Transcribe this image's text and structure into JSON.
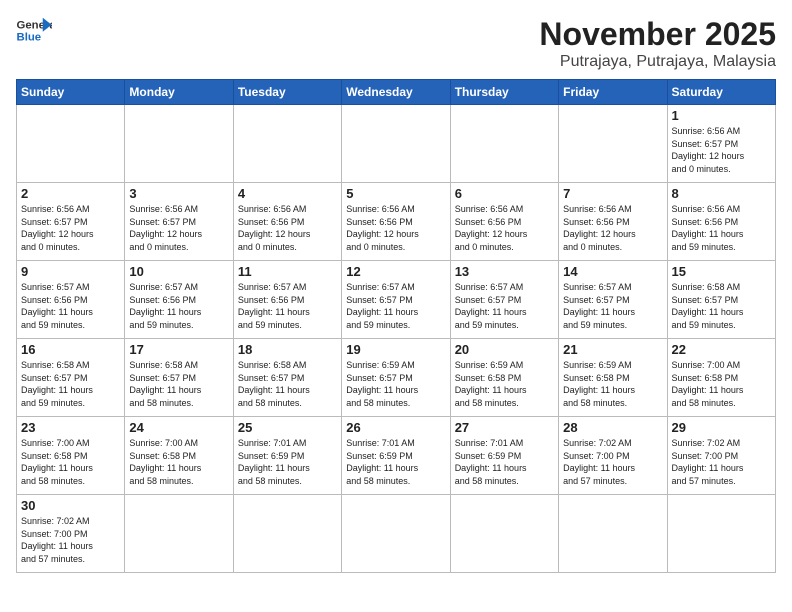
{
  "header": {
    "logo_line1": "General",
    "logo_line2": "Blue",
    "month_title": "November 2025",
    "location": "Putrajaya, Putrajaya, Malaysia"
  },
  "weekdays": [
    "Sunday",
    "Monday",
    "Tuesday",
    "Wednesday",
    "Thursday",
    "Friday",
    "Saturday"
  ],
  "weeks": [
    [
      {
        "day": "",
        "info": ""
      },
      {
        "day": "",
        "info": ""
      },
      {
        "day": "",
        "info": ""
      },
      {
        "day": "",
        "info": ""
      },
      {
        "day": "",
        "info": ""
      },
      {
        "day": "",
        "info": ""
      },
      {
        "day": "1",
        "info": "Sunrise: 6:56 AM\nSunset: 6:57 PM\nDaylight: 12 hours\nand 0 minutes."
      }
    ],
    [
      {
        "day": "2",
        "info": "Sunrise: 6:56 AM\nSunset: 6:57 PM\nDaylight: 12 hours\nand 0 minutes."
      },
      {
        "day": "3",
        "info": "Sunrise: 6:56 AM\nSunset: 6:57 PM\nDaylight: 12 hours\nand 0 minutes."
      },
      {
        "day": "4",
        "info": "Sunrise: 6:56 AM\nSunset: 6:56 PM\nDaylight: 12 hours\nand 0 minutes."
      },
      {
        "day": "5",
        "info": "Sunrise: 6:56 AM\nSunset: 6:56 PM\nDaylight: 12 hours\nand 0 minutes."
      },
      {
        "day": "6",
        "info": "Sunrise: 6:56 AM\nSunset: 6:56 PM\nDaylight: 12 hours\nand 0 minutes."
      },
      {
        "day": "7",
        "info": "Sunrise: 6:56 AM\nSunset: 6:56 PM\nDaylight: 12 hours\nand 0 minutes."
      },
      {
        "day": "8",
        "info": "Sunrise: 6:56 AM\nSunset: 6:56 PM\nDaylight: 11 hours\nand 59 minutes."
      }
    ],
    [
      {
        "day": "9",
        "info": "Sunrise: 6:57 AM\nSunset: 6:56 PM\nDaylight: 11 hours\nand 59 minutes."
      },
      {
        "day": "10",
        "info": "Sunrise: 6:57 AM\nSunset: 6:56 PM\nDaylight: 11 hours\nand 59 minutes."
      },
      {
        "day": "11",
        "info": "Sunrise: 6:57 AM\nSunset: 6:56 PM\nDaylight: 11 hours\nand 59 minutes."
      },
      {
        "day": "12",
        "info": "Sunrise: 6:57 AM\nSunset: 6:57 PM\nDaylight: 11 hours\nand 59 minutes."
      },
      {
        "day": "13",
        "info": "Sunrise: 6:57 AM\nSunset: 6:57 PM\nDaylight: 11 hours\nand 59 minutes."
      },
      {
        "day": "14",
        "info": "Sunrise: 6:57 AM\nSunset: 6:57 PM\nDaylight: 11 hours\nand 59 minutes."
      },
      {
        "day": "15",
        "info": "Sunrise: 6:58 AM\nSunset: 6:57 PM\nDaylight: 11 hours\nand 59 minutes."
      }
    ],
    [
      {
        "day": "16",
        "info": "Sunrise: 6:58 AM\nSunset: 6:57 PM\nDaylight: 11 hours\nand 59 minutes."
      },
      {
        "day": "17",
        "info": "Sunrise: 6:58 AM\nSunset: 6:57 PM\nDaylight: 11 hours\nand 58 minutes."
      },
      {
        "day": "18",
        "info": "Sunrise: 6:58 AM\nSunset: 6:57 PM\nDaylight: 11 hours\nand 58 minutes."
      },
      {
        "day": "19",
        "info": "Sunrise: 6:59 AM\nSunset: 6:57 PM\nDaylight: 11 hours\nand 58 minutes."
      },
      {
        "day": "20",
        "info": "Sunrise: 6:59 AM\nSunset: 6:58 PM\nDaylight: 11 hours\nand 58 minutes."
      },
      {
        "day": "21",
        "info": "Sunrise: 6:59 AM\nSunset: 6:58 PM\nDaylight: 11 hours\nand 58 minutes."
      },
      {
        "day": "22",
        "info": "Sunrise: 7:00 AM\nSunset: 6:58 PM\nDaylight: 11 hours\nand 58 minutes."
      }
    ],
    [
      {
        "day": "23",
        "info": "Sunrise: 7:00 AM\nSunset: 6:58 PM\nDaylight: 11 hours\nand 58 minutes."
      },
      {
        "day": "24",
        "info": "Sunrise: 7:00 AM\nSunset: 6:58 PM\nDaylight: 11 hours\nand 58 minutes."
      },
      {
        "day": "25",
        "info": "Sunrise: 7:01 AM\nSunset: 6:59 PM\nDaylight: 11 hours\nand 58 minutes."
      },
      {
        "day": "26",
        "info": "Sunrise: 7:01 AM\nSunset: 6:59 PM\nDaylight: 11 hours\nand 58 minutes."
      },
      {
        "day": "27",
        "info": "Sunrise: 7:01 AM\nSunset: 6:59 PM\nDaylight: 11 hours\nand 58 minutes."
      },
      {
        "day": "28",
        "info": "Sunrise: 7:02 AM\nSunset: 7:00 PM\nDaylight: 11 hours\nand 57 minutes."
      },
      {
        "day": "29",
        "info": "Sunrise: 7:02 AM\nSunset: 7:00 PM\nDaylight: 11 hours\nand 57 minutes."
      }
    ],
    [
      {
        "day": "30",
        "info": "Sunrise: 7:02 AM\nSunset: 7:00 PM\nDaylight: 11 hours\nand 57 minutes."
      },
      {
        "day": "",
        "info": ""
      },
      {
        "day": "",
        "info": ""
      },
      {
        "day": "",
        "info": ""
      },
      {
        "day": "",
        "info": ""
      },
      {
        "day": "",
        "info": ""
      },
      {
        "day": "",
        "info": ""
      }
    ]
  ]
}
